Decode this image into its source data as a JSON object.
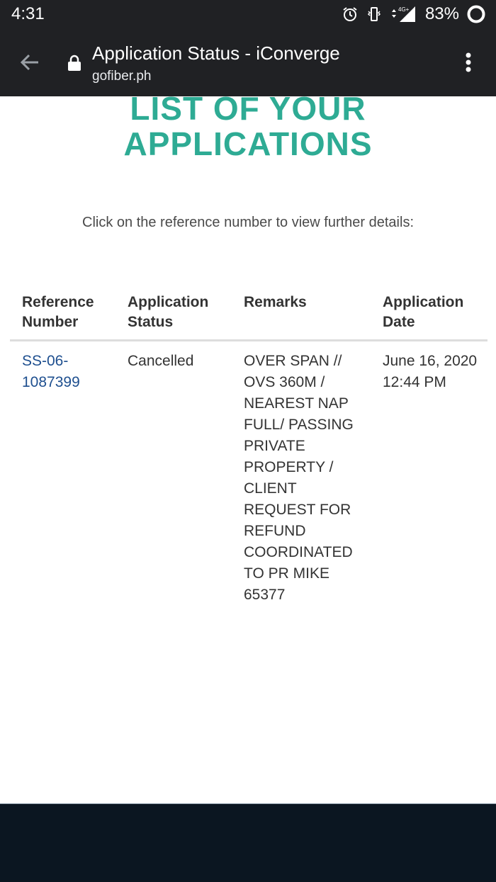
{
  "status_bar": {
    "time": "4:31",
    "icons": [
      "alarm-icon",
      "vibrate-icon",
      "data-arrows-icon",
      "signal-4g-icon"
    ],
    "network_label": "4G+",
    "battery": "83%"
  },
  "browser": {
    "page_title": "Application Status - iConverge",
    "url": "gofiber.ph"
  },
  "page": {
    "heading_line1": "LIST OF YOUR",
    "heading_line2": "APPLICATIONS",
    "instruction": "Click on the reference number to view further details:",
    "heading_color": "#2eab94",
    "link_color": "#1e4f8f"
  },
  "table": {
    "headers": [
      {
        "line1": "Reference",
        "line2": "Number"
      },
      {
        "line1": "Application",
        "line2": "Status"
      },
      {
        "line1": "Remarks",
        "line2": ""
      },
      {
        "line1": "Application",
        "line2": "Date"
      }
    ],
    "rows": [
      {
        "reference_number": "SS-06-1087399",
        "status": "Cancelled",
        "remarks": "OVER SPAN //  OVS 360M / NEAREST NAP FULL/ PASSING PRIVATE PROPERTY / CLIENT REQUEST FOR REFUND COORDINATED TO PR MIKE 65377",
        "date": "June 16, 2020 12:44 PM"
      }
    ]
  }
}
